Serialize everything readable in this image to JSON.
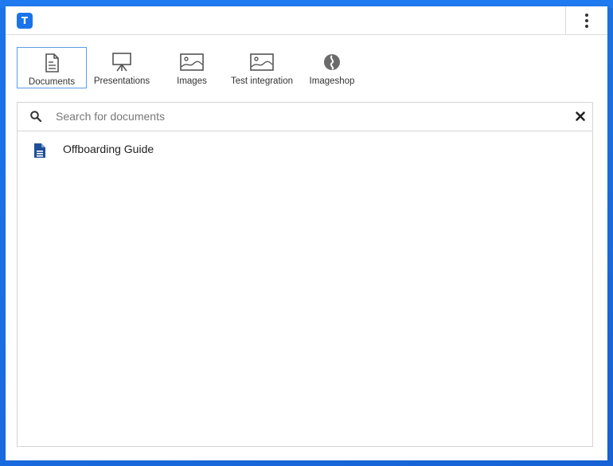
{
  "app": {
    "logo_letter": "T",
    "accent_color": "#1a73e8"
  },
  "header": {
    "menu_icon": "vertical-ellipsis-icon"
  },
  "tabs": [
    {
      "label": "Documents",
      "icon": "document-icon",
      "active": true
    },
    {
      "label": "Presentations",
      "icon": "presentation-easel-icon",
      "active": false
    },
    {
      "label": "Images",
      "icon": "image-icon",
      "active": false
    },
    {
      "label": "Test integration",
      "icon": "image-icon",
      "active": false
    },
    {
      "label": "Imageshop",
      "icon": "imageshop-logo-icon",
      "active": false
    }
  ],
  "search": {
    "placeholder": "Search for documents",
    "value": "",
    "search_icon": "search-icon",
    "clear_icon": "close-icon"
  },
  "results": [
    {
      "title": "Offboarding Guide",
      "icon": "document-file-icon",
      "icon_color": "#1f4e99"
    }
  ]
}
